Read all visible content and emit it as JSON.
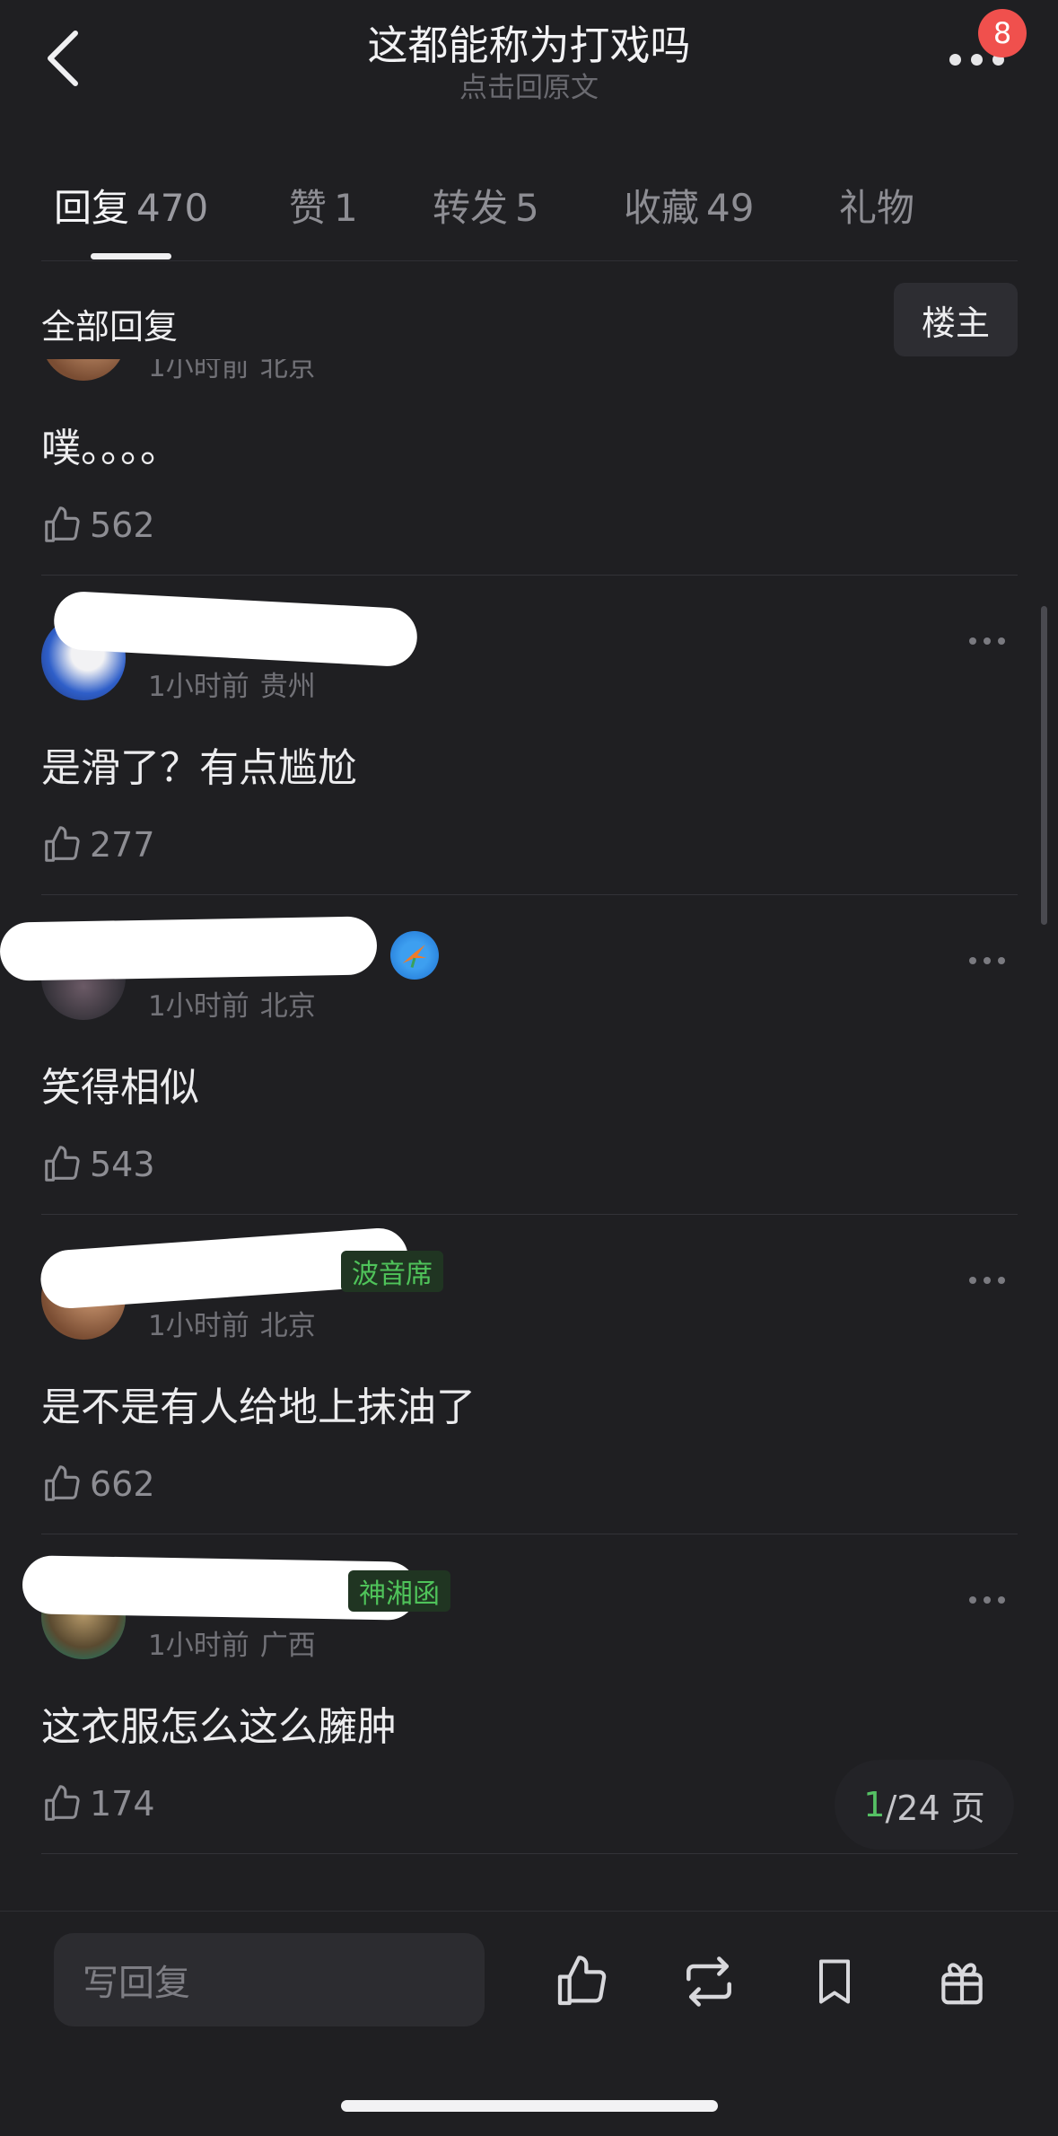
{
  "header": {
    "title": "这都能称为打戏吗",
    "subtitle": "点击回原文",
    "notification_count": "8"
  },
  "tabs": [
    {
      "label": "回复",
      "count": "470",
      "active": true
    },
    {
      "label": "赞",
      "count": "1",
      "active": false
    },
    {
      "label": "转发",
      "count": "5",
      "active": false
    },
    {
      "label": "收藏",
      "count": "49",
      "active": false
    },
    {
      "label": "礼物",
      "count": "",
      "active": false
    }
  ],
  "filter": {
    "label": "全部回复",
    "button": "楼主"
  },
  "comments": [
    {
      "time": "1小时前",
      "location": "北京",
      "text": "噗。。。。",
      "likes": "562",
      "tag": ""
    },
    {
      "time": "1小时前",
      "location": "贵州",
      "text": "是滑了？有点尴尬",
      "likes": "277",
      "tag": ""
    },
    {
      "time": "1小时前",
      "location": "北京",
      "text": "笑得相似",
      "likes": "543",
      "tag": ""
    },
    {
      "time": "1小时前",
      "location": "北京",
      "text": "是不是有人给地上抹油了",
      "likes": "662",
      "tag": "波音席"
    },
    {
      "time": "1小时前",
      "location": "广西",
      "text": "这衣服怎么这么臃肿",
      "likes": "174",
      "tag": "神湘函"
    }
  ],
  "pager": {
    "current": "1",
    "total": "/24 页"
  },
  "bottom": {
    "reply_placeholder": "写回复"
  },
  "icons": {
    "back": "chevron-left-icon",
    "more": "more-dots-icon",
    "like": "thumbs-up-icon",
    "repost": "repost-icon",
    "bookmark": "bookmark-icon",
    "gift": "gift-icon"
  },
  "colors": {
    "background": "#1f1f22",
    "badge": "#f0504d",
    "tag_green": "#4fc35a",
    "pager_current": "#55c064"
  }
}
